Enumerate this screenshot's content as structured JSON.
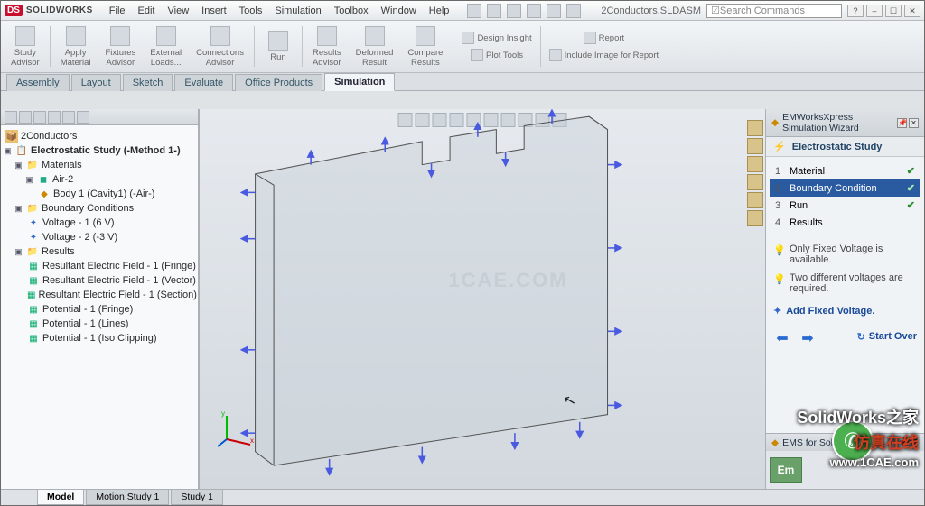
{
  "app": {
    "brand_ds": "DS",
    "brand_sw": "SOLIDWORKS",
    "document": "2Conductors.SLDASM",
    "search_placeholder": "Search Commands"
  },
  "menus": [
    "File",
    "Edit",
    "View",
    "Insert",
    "Tools",
    "Simulation",
    "Toolbox",
    "Window",
    "Help"
  ],
  "ribbon": {
    "big": [
      {
        "label": "Study\nAdvisor"
      },
      {
        "label": "Apply\nMaterial"
      },
      {
        "label": "Fixtures\nAdvisor"
      },
      {
        "label": "External\nLoads..."
      },
      {
        "label": "Connections\nAdvisor"
      },
      {
        "label": "Run"
      },
      {
        "label": "Results\nAdvisor"
      },
      {
        "label": "Deformed\nResult"
      },
      {
        "label": "Compare\nResults"
      }
    ],
    "small_a": [
      "Design Insight",
      "Plot Tools"
    ],
    "small_b": [
      "Report",
      "Include Image for Report"
    ]
  },
  "tabs": [
    "Assembly",
    "Layout",
    "Sketch",
    "Evaluate",
    "Office Products",
    "Simulation"
  ],
  "tabs_active": 5,
  "tree": {
    "root": "2Conductors",
    "study": "Electrostatic Study (-Method 1-)",
    "materials": "Materials",
    "mat_items": [
      "Air-2",
      "Body 1 (Cavity1) (-Air-)"
    ],
    "bc": "Boundary Conditions",
    "bc_items": [
      "Voltage - 1 (6 V)",
      "Voltage - 2 (-3 V)"
    ],
    "results": "Results",
    "res_items": [
      "Resultant Electric Field - 1 (Fringe)",
      "Resultant Electric Field - 1 (Vector)",
      "Resultant Electric Field - 1 (Section)",
      "Potential - 1 (Fringe)",
      "Potential - 1 (Lines)",
      "Potential - 1 (Iso Clipping)"
    ]
  },
  "wizard": {
    "title": "EMWorksXpress Simulation Wizard",
    "subtitle": "Electrostatic Study",
    "steps": [
      {
        "n": "1",
        "label": "Material",
        "done": true
      },
      {
        "n": "2",
        "label": "Boundary Condition",
        "done": true,
        "selected": true
      },
      {
        "n": "3",
        "label": "Run",
        "done": true
      },
      {
        "n": "4",
        "label": "Results",
        "done": false
      }
    ],
    "notes": [
      "Only Fixed Voltage is available.",
      "Two different voltages are required."
    ],
    "action": "Add Fixed Voltage.",
    "start_over": "Start Over",
    "ems_title": "EMS for SolidWorks"
  },
  "bottom_tabs": [
    "Model",
    "Motion Study 1",
    "  Study 1"
  ],
  "bottom_active": 0,
  "watermark": "1CAE.COM",
  "overlay": {
    "line1": "SolidWorks之家",
    "line2": "仿真在线",
    "url": "www.1CAE.com"
  }
}
